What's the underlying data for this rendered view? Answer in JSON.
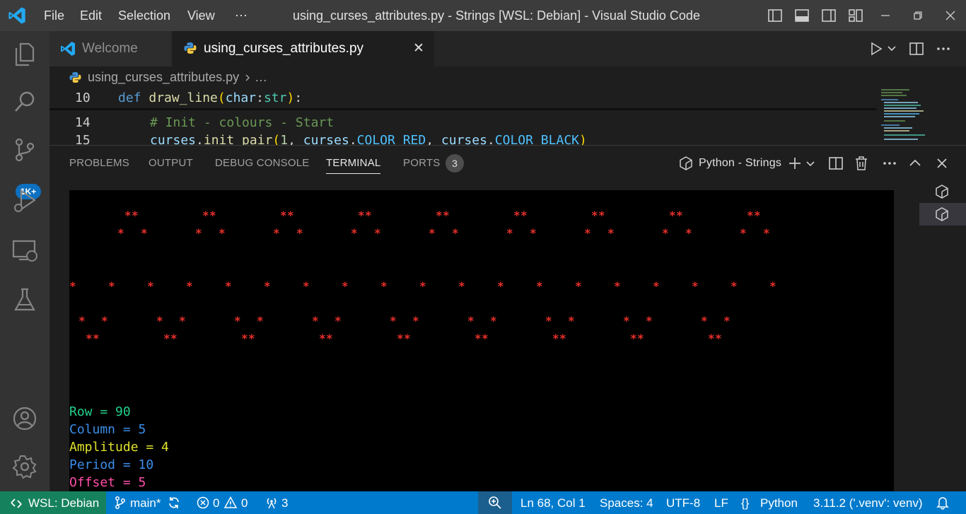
{
  "window": {
    "menu": [
      "File",
      "Edit",
      "Selection",
      "View",
      "⋯"
    ],
    "title": "using_curses_attributes.py - Strings [WSL: Debian] - Visual Studio Code"
  },
  "activity_bar": {
    "badge": "1K+"
  },
  "tabs": [
    {
      "label": "Welcome",
      "icon": "vscode-icon"
    },
    {
      "label": "using_curses_attributes.py",
      "icon": "python-icon",
      "close": "✕"
    }
  ],
  "breadcrumb": {
    "file": "using_curses_attributes.py",
    "rest": "…"
  },
  "code": {
    "lines": [
      {
        "num": "10",
        "text": "def draw_line(char:str):"
      },
      {
        "num": "14",
        "text": "    # Init - colours - Start"
      },
      {
        "num": "15",
        "text": "    curses.init_pair(1, curses.COLOR_RED, curses.COLOR_BLACK)"
      }
    ]
  },
  "panel": {
    "tabs": [
      "PROBLEMS",
      "OUTPUT",
      "DEBUG CONSOLE",
      "TERMINAL",
      "PORTS"
    ],
    "active_tab": "TERMINAL",
    "ports_count": "3",
    "terminal_name": "Python - Strings"
  },
  "terminal": {
    "star_color": "#e8302a",
    "star_glyph": "*",
    "info_lines": [
      {
        "text": "Row = 90",
        "color": "#23d18b"
      },
      {
        "text": "Column = 5",
        "color": "#3b8eea"
      },
      {
        "text": "Amplitude = 4",
        "color": "#dfe22b"
      },
      {
        "text": "Period = 10",
        "color": "#3b8eea"
      },
      {
        "text": "Offset = 5",
        "color": "#ff4fa8"
      }
    ]
  },
  "status_bar": {
    "remote": "WSL: Debian",
    "branch": "main*",
    "errors": "0",
    "warnings": "0",
    "ports": "3",
    "position": "Ln 68, Col 1",
    "spaces": "Spaces: 4",
    "encoding": "UTF-8",
    "eol": "LF",
    "language": "Python",
    "interpreter": "3.11.2 ('.venv': venv)"
  },
  "colors": {
    "accent": "#007acc",
    "remote": "#16825d",
    "keyword": "#569cd6",
    "function": "#dcdcaa",
    "comment": "#6a9955",
    "type": "#4ec9b0",
    "variable": "#9cdcfe"
  }
}
